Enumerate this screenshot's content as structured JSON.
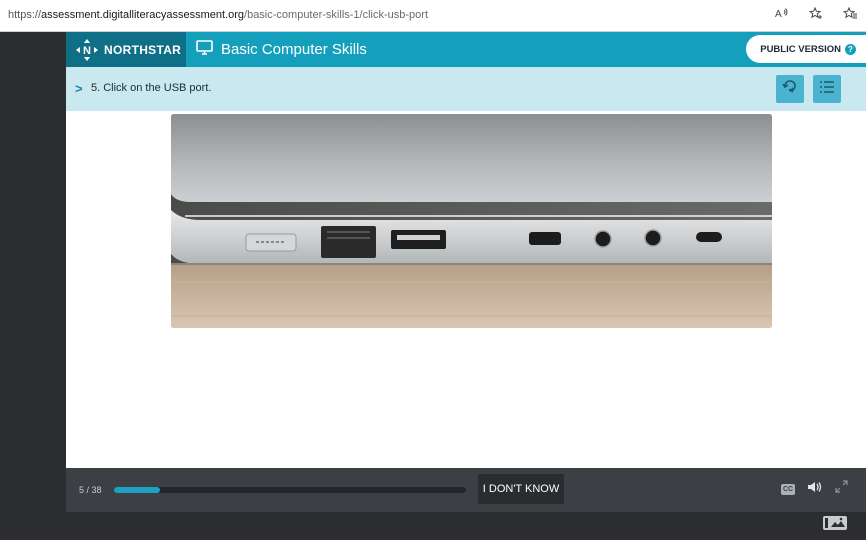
{
  "browser": {
    "url_prefix": "https://",
    "url_host": "assessment.digitalliteracyassessment.org",
    "url_path": "/basic-computer-skills-1/click-usb-port",
    "icons": [
      "read-aloud-icon",
      "favorite-add-icon",
      "favorites-icon"
    ]
  },
  "header": {
    "brand": "NORTHSTAR",
    "course_title": "Basic Computer Skills",
    "public_version_label": "PUBLIC VERSION"
  },
  "question": {
    "text": "5. Click on the USB port."
  },
  "progress": {
    "label": "5 / 38",
    "fraction": 0.131
  },
  "bottom": {
    "dont_know_label": "I DON'T KNOW",
    "cc_label": "CC"
  },
  "colors": {
    "accent": "#14a0bd",
    "brand_dark": "#0f6f86",
    "question_bar": "#c9e8f0",
    "progress_fill": "#1ea0c4"
  }
}
